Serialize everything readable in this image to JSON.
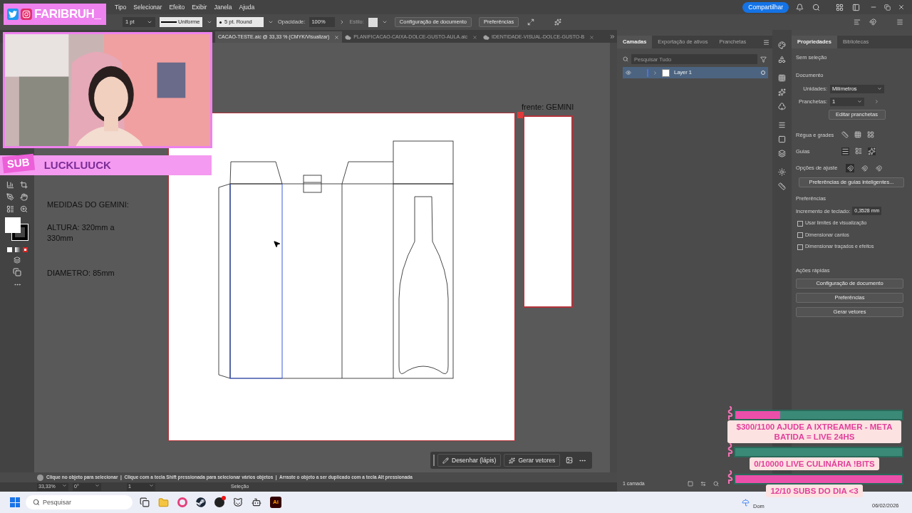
{
  "menu": [
    "Tipo",
    "Selecionar",
    "Efeito",
    "Exibir",
    "Janela",
    "Ajuda"
  ],
  "share_button": "Compartilhar",
  "control_bar": {
    "stroke_weight": "1 pt",
    "stroke_profile": "Uniforme",
    "brush": "5 pt. Round",
    "opacity_label": "Opacidade:",
    "opacity": "100%",
    "style_label": "Estilo:",
    "buttons": [
      "Configuração de documento",
      "Preferências"
    ]
  },
  "doc_tabs": [
    {
      "label": "CACAO-TESTE.aic @ 33,33 % (CMYK/Visualizar)",
      "selected": true,
      "cloud": false
    },
    {
      "label": "PLANIFICACAO-CAIXA-DOLCE-GUSTO-AULA.aic",
      "selected": false,
      "cloud": true
    },
    {
      "label": "IDENTIDADE-VISUAL-DOLCE-GUSTO-B",
      "selected": false,
      "cloud": true
    }
  ],
  "canvas": {
    "notes": [
      "MEDIDAS DO GEMINI:",
      "ALTURA: 320mm a 330mm",
      "DIAMETRO: 85mm"
    ],
    "artboard_label": "frente: GEMINI"
  },
  "floating_bar": [
    "Desenhar (lápis)",
    "Gerar vetores"
  ],
  "status_hint": "Clique no objeto para selecionar  |  Clique com a tecla Shift pressionada para selecionar vários objetos  |  Arraste o objeto a ser duplicado com a tecla Alt pressionada",
  "status_bar": {
    "zoom": "33,33%",
    "rotation": "0°",
    "artboard": "1",
    "tool": "Seleção"
  },
  "layers_panel": {
    "tabs": [
      {
        "label": "Camadas",
        "selected": true
      },
      {
        "label": "Exportação de ativos",
        "selected": false
      },
      {
        "label": "Pranchetas",
        "selected": false
      }
    ],
    "search_placeholder": "Pesquisar Tudo",
    "layers": [
      {
        "name": "Layer 1",
        "visible": true,
        "selected": true
      }
    ],
    "footer": "1 camada"
  },
  "properties_panel": {
    "tabs": [
      {
        "label": "Propriedades",
        "selected": true
      },
      {
        "label": "Bibliotecas",
        "selected": false
      }
    ],
    "no_selection": "Sem seleção",
    "document_heading": "Documento",
    "units_label": "Unidades:",
    "units": "Milímetros",
    "artboard_label": "Pranchetas:",
    "artboard": "1",
    "edit_artboards": "Editar pranchetas",
    "rulers_label": "Régua e grades",
    "guides_label": "Guias",
    "snap_label": "Opções de ajuste",
    "snap_options": [
      {
        "selected": true
      },
      {
        "selected": false
      },
      {
        "selected": false
      }
    ],
    "smart_guides_button": "Preferências de guias inteligentes...",
    "preferences_heading": "Preferências",
    "key_increment_label": "Incremento de teclado:",
    "key_increment": "0,3528 mm",
    "options": [
      {
        "label": "Usar limites de visualização",
        "checked": false
      },
      {
        "label": "Dimensionar cantos",
        "checked": false
      },
      {
        "label": "Dimensionar traçados e efeitos",
        "checked": false
      }
    ],
    "quick_actions_heading": "Ações rápidas",
    "quick_actions": [
      "Configuração de documento",
      "Preferências",
      "Gerar vetores"
    ]
  },
  "taskbar": {
    "search_placeholder": "Pesquisar",
    "app_badge": "Ai",
    "weather": "Dom",
    "date": "06/02/2026"
  },
  "overlays": {
    "handle": "FARIBRUH_",
    "sub_label": "SUB",
    "subscriber": "LUCKLUUCK",
    "goals": [
      {
        "text": "$300/1100 AJUDE A IXTREAMER - META BATIDA = LIVE 24HS",
        "level": 0.27
      },
      {
        "text": "0/10000 LIVE CULINÁRIA !BITS",
        "level": 0
      },
      {
        "text": "12/10 SUBS DO DIA <3",
        "level": 1
      }
    ]
  }
}
